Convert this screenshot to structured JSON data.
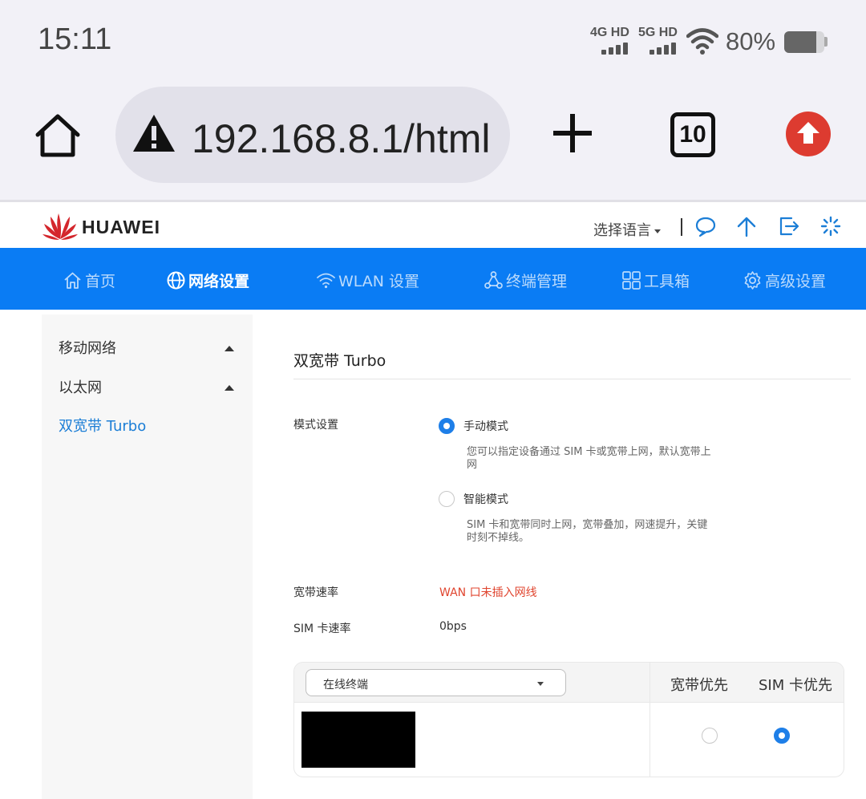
{
  "status_bar": {
    "time": "15:11",
    "signal_1": {
      "label": "4G HD",
      "bars": 4
    },
    "signal_2": {
      "label": "5G HD",
      "bars": 4
    },
    "wifi": "wifi-icon",
    "battery_percent_text": "80%",
    "battery_level": 0.8
  },
  "browser": {
    "url": "192.168.8.1/html",
    "tab_count": "10",
    "security": "warning-icon"
  },
  "header": {
    "brand": "HUAWEI",
    "language_label": "选择语言"
  },
  "nav": {
    "items": [
      {
        "label": "首页",
        "icon": "home-icon"
      },
      {
        "label": "网络设置",
        "icon": "globe-icon",
        "active": true
      },
      {
        "label": "WLAN 设置",
        "icon": "wifi-icon"
      },
      {
        "label": "终端管理",
        "icon": "devices-icon"
      },
      {
        "label": "工具箱",
        "icon": "grid-icon"
      },
      {
        "label": "高级设置",
        "icon": "gear-icon"
      }
    ]
  },
  "sidebar": {
    "items": [
      {
        "label": "移动网络"
      },
      {
        "label": "以太网"
      },
      {
        "label": "双宽带 Turbo",
        "active": true
      }
    ]
  },
  "main": {
    "title": "双宽带 Turbo",
    "mode": {
      "label": "模式设置",
      "options": [
        {
          "label": "手动模式",
          "desc": "您可以指定设备通过 SIM 卡或宽带上网，默认宽带上网",
          "selected": true
        },
        {
          "label": "智能模式",
          "desc": "SIM 卡和宽带同时上网，宽带叠加，网速提升，关键时刻不掉线。",
          "selected": false
        }
      ]
    },
    "broadband_rate": {
      "label": "宽带速率",
      "value": "WAN 口未插入网线",
      "value_color": "#e0452f"
    },
    "sim_rate": {
      "label": "SIM 卡速率",
      "value": "0bps"
    },
    "table": {
      "select_value": "在线终端",
      "columns": [
        "宽带优先",
        "SIM 卡优先"
      ],
      "row": {
        "broadband_selected": false,
        "sim_selected": true
      }
    }
  },
  "colors": {
    "accent": "#0a7cf4",
    "active_link": "#1c7ed6",
    "update_button": "#dd3b30"
  }
}
